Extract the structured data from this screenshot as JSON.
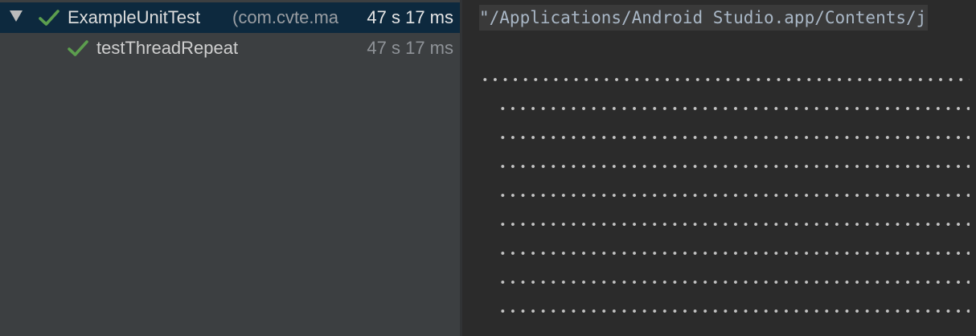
{
  "test_tree": {
    "root": {
      "name": "ExampleUnitTest",
      "package": "(com.cvte.ma",
      "duration": "47 s 17 ms",
      "status": "passed",
      "status_icon": "check-icon",
      "expanded": true,
      "selected": true
    },
    "children": [
      {
        "name": "testThreadRepeat",
        "duration": "47 s 17 ms",
        "status": "passed",
        "status_icon": "check-icon"
      }
    ]
  },
  "console": {
    "command": "\"/Applications/Android Studio.app/Contents/j",
    "output_lines": [
      "........................................................................",
      "........................................................................",
      "........................................................................",
      "........................................................................",
      "........................................................................",
      "........................................................................",
      "........................................................................",
      "........................................................................",
      "........................................................................"
    ]
  },
  "colors": {
    "tree_background": "#3c3f41",
    "selection_background": "#0d293e",
    "console_background": "#2b2b2b",
    "passed_check": "#5c9e4e"
  }
}
